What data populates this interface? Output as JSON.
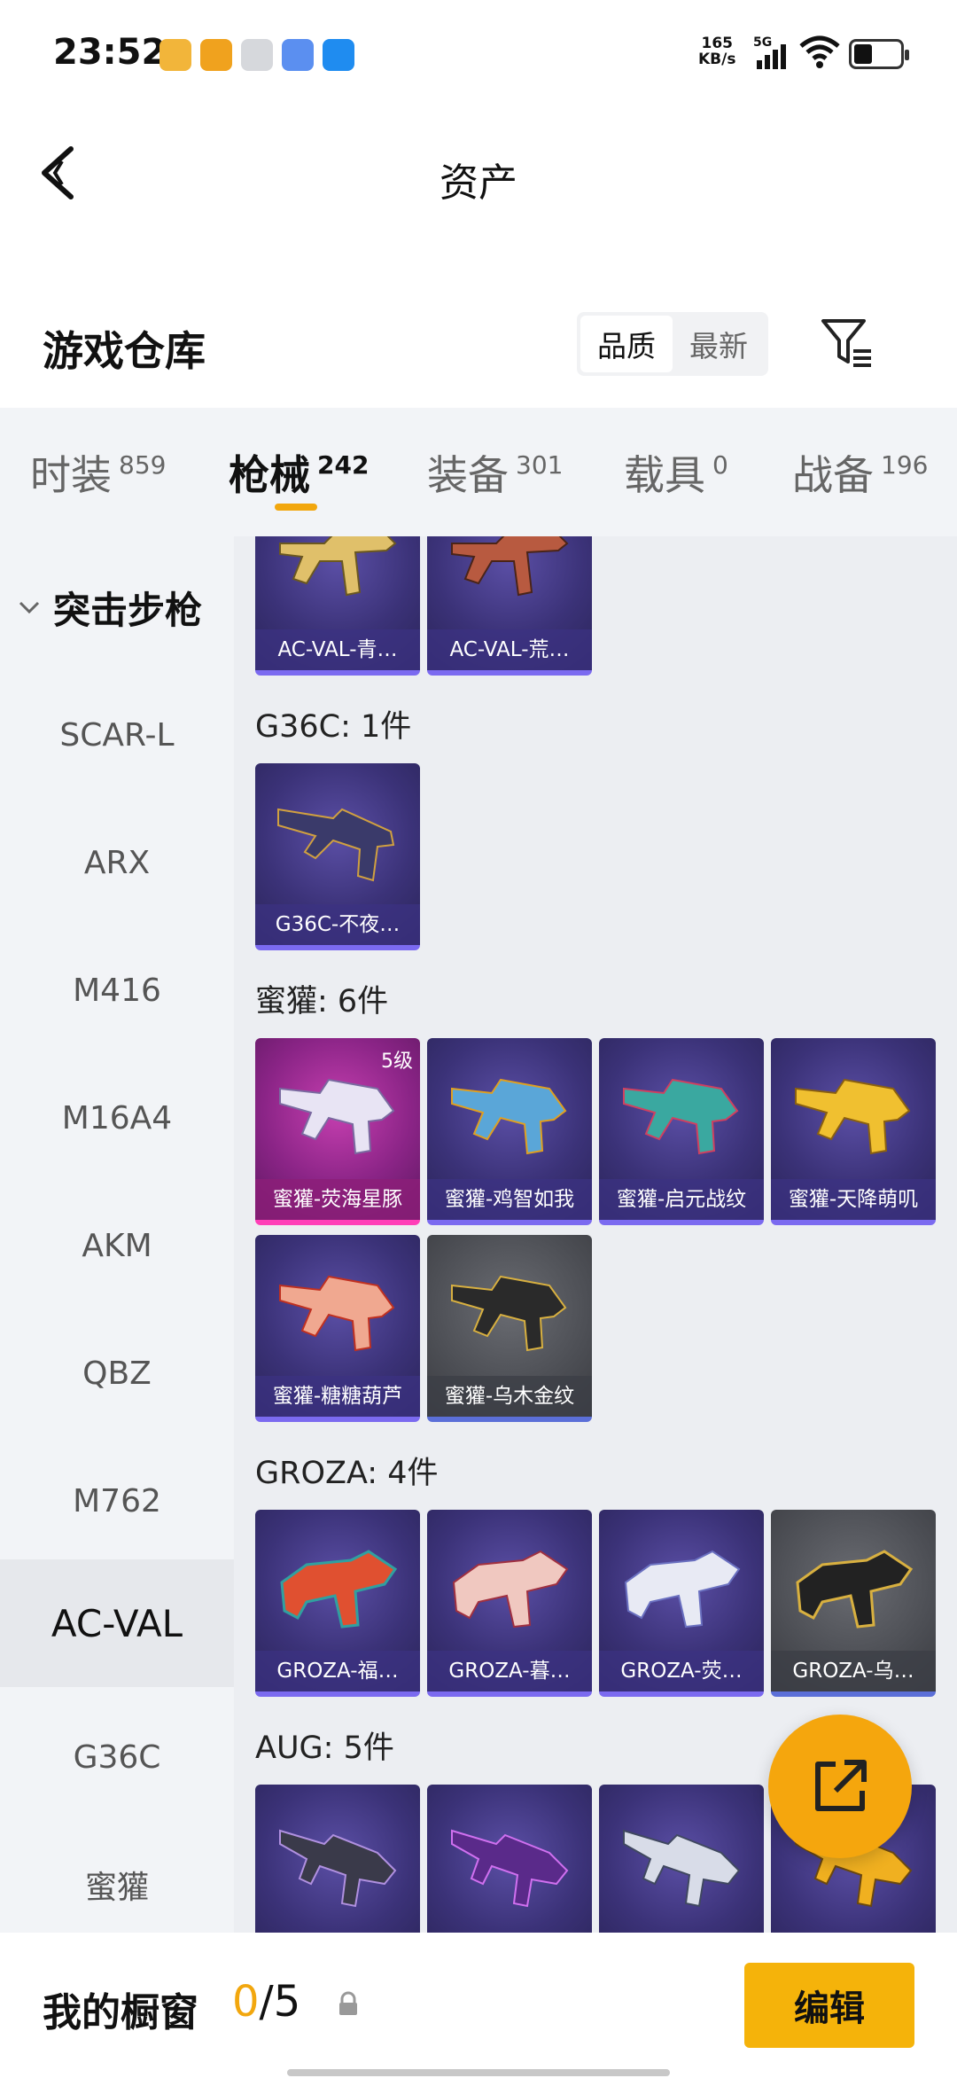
{
  "status_bar": {
    "time": "23:52",
    "speed_value": "165",
    "speed_unit": "KB/s",
    "network": "5G"
  },
  "header": {
    "title": "资产"
  },
  "section": {
    "title": "游戏仓库",
    "sort_quality": "品质",
    "sort_latest": "最新"
  },
  "tabs": [
    {
      "label": "时装",
      "count": "859"
    },
    {
      "label": "枪械",
      "count": "242"
    },
    {
      "label": "装备",
      "count": "301"
    },
    {
      "label": "载具",
      "count": "0"
    },
    {
      "label": "战备",
      "count": "196"
    }
  ],
  "sidebar": {
    "group": "突击步枪",
    "items": [
      "SCAR-L",
      "ARX",
      "M416",
      "M16A4",
      "AKM",
      "QBZ",
      "M762",
      "AC-VAL",
      "G36C",
      "蜜獾"
    ]
  },
  "content": {
    "top_cards": [
      "AC-VAL-青…",
      "AC-VAL-荒…"
    ],
    "groups": [
      {
        "label": "G36C: 1件",
        "cards": [
          "G36C-不夜…"
        ]
      },
      {
        "label": "蜜獾: 6件",
        "cards": [
          "蜜獾-荧海星豚",
          "蜜獾-鸡智如我",
          "蜜獾-启元战纹",
          "蜜獾-天降萌叽",
          "蜜獾-糖糖葫芦",
          "蜜獾-乌木金纹"
        ],
        "badge": "5级"
      },
      {
        "label": "GROZA: 4件",
        "cards": [
          "GROZA-福…",
          "GROZA-暮…",
          "GROZA-荧…",
          "GROZA-乌…"
        ]
      },
      {
        "label": "AUG: 5件"
      }
    ]
  },
  "bottom_bar": {
    "label": "我的橱窗",
    "count_current": "0",
    "count_sep_total": "/5",
    "edit": "编辑"
  },
  "colors": {
    "accent": "#f5b30a",
    "purple_card": "#3b3278",
    "legend_card": "#8a2486"
  }
}
